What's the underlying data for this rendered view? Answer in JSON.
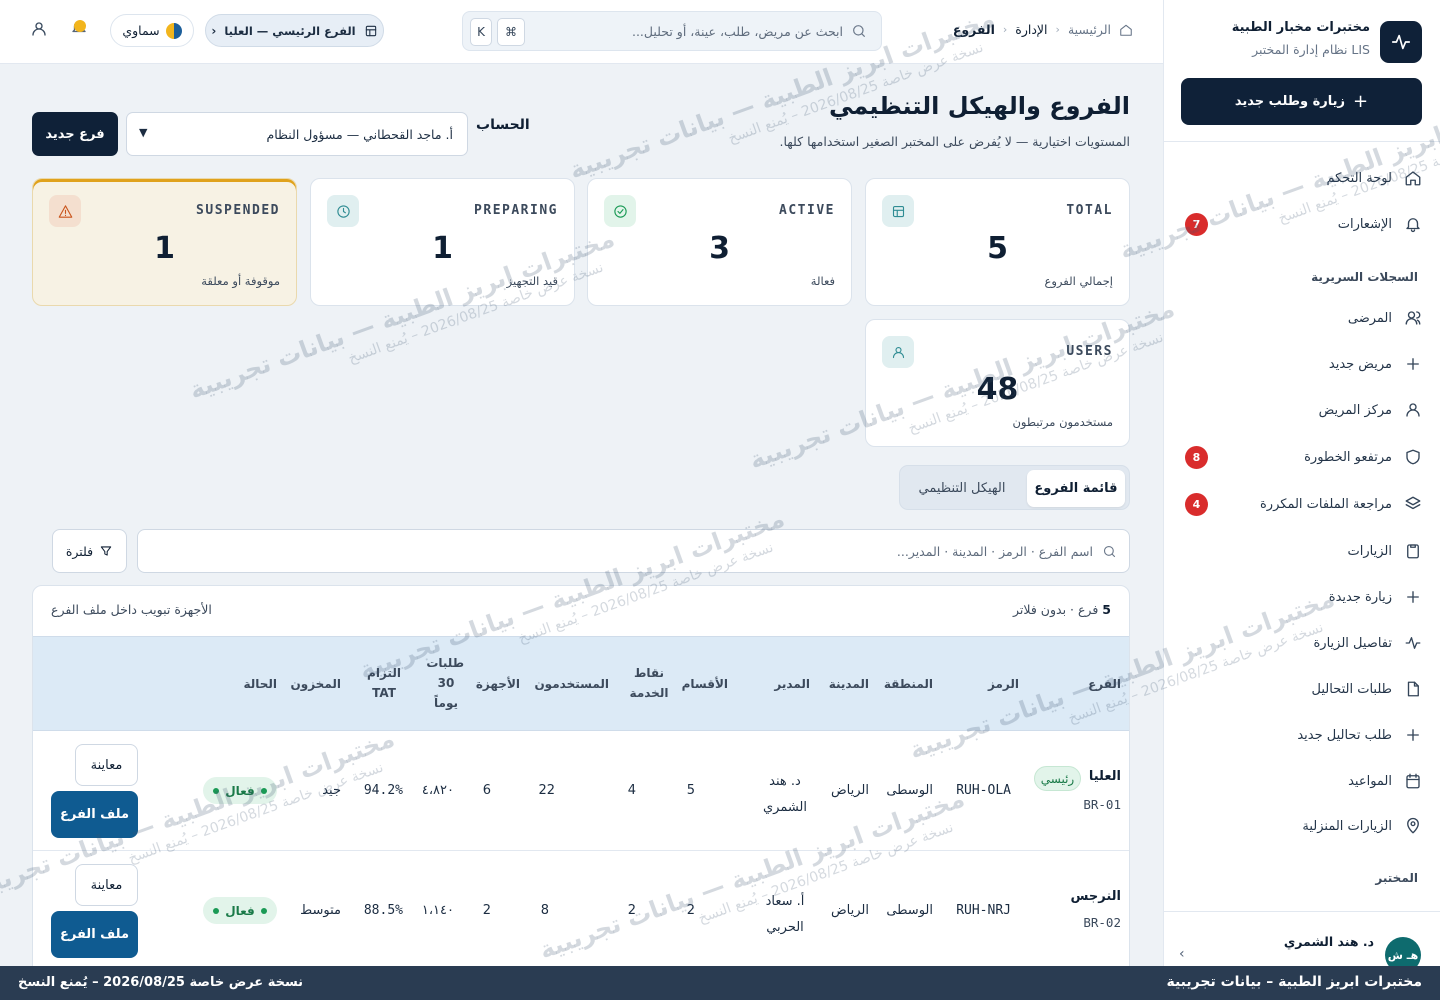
{
  "brand": {
    "title": "مختبرات مخبار الطبية",
    "subtitle": "نظام إدارة المختبر LIS",
    "cta_label": "زيارة وطلب جديد"
  },
  "nav": {
    "items": [
      {
        "label": "لوحة التحكم",
        "icon": "home-icon",
        "badge": ""
      },
      {
        "label": "الإشعارات",
        "icon": "bell-icon",
        "badge": "7"
      },
      {
        "label": "المرضى",
        "icon": "users-icon",
        "badge": ""
      },
      {
        "label": "مريض جديد",
        "icon": "plus-icon",
        "badge": ""
      },
      {
        "label": "مركز المريض",
        "icon": "user-icon",
        "badge": ""
      },
      {
        "label": "مرتفعو الخطورة",
        "icon": "shield-icon",
        "badge": "8"
      },
      {
        "label": "مراجعة الملفات المكررة",
        "icon": "layers-icon",
        "badge": "4"
      },
      {
        "label": "الزيارات",
        "icon": "clipboard-icon",
        "badge": ""
      },
      {
        "label": "زيارة جديدة",
        "icon": "plus-icon",
        "badge": ""
      },
      {
        "label": "تفاصيل الزيارة",
        "icon": "pulse-icon",
        "badge": ""
      },
      {
        "label": "طلبات التحاليل",
        "icon": "file-icon",
        "badge": ""
      },
      {
        "label": "طلب تحاليل جديد",
        "icon": "plus-icon",
        "badge": ""
      },
      {
        "label": "المواعيد",
        "icon": "calendar-icon",
        "badge": ""
      },
      {
        "label": "الزيارات المنزلية",
        "icon": "map-pin-icon",
        "badge": ""
      }
    ],
    "section_clinical": "السجلات السريرية",
    "section_lab": "المختبر"
  },
  "user": {
    "name": "د. هند الشمري",
    "initials": "هـ ش"
  },
  "topbar": {
    "breadcrumbs": [
      "الرئيسية",
      "الإدارة",
      "الفروع"
    ],
    "search_placeholder": "ابحث عن مريض، طلب، عينة، أو تحليل...",
    "kbd_cmd": "⌘",
    "kbd_k": "K",
    "branch_label": "الفرع الرئيسي — العليا",
    "theme_label": "سماوي"
  },
  "page": {
    "title": "الفروع والهيكل التنظيمي",
    "subtitle": "المستويات اختيارية — لا يُفرض على المختبر الصغير استخدامها كلها.",
    "account_label": "الحساب",
    "account_value": "أ. ماجد القحطاني — مسؤول النظام",
    "new_branch_label": "فرع جديد"
  },
  "stats": [
    {
      "label": "TOTAL",
      "value": "5",
      "caption": "إجمالي الفروع",
      "icon": "building-icon",
      "color": "#2f8c93"
    },
    {
      "label": "ACTIVE",
      "value": "3",
      "caption": "فعالة",
      "icon": "check-circle-icon",
      "color": "#1a9a55"
    },
    {
      "label": "PREPARING",
      "value": "1",
      "caption": "قيد التجهيز",
      "icon": "clock-icon",
      "color": "#2f8c93"
    },
    {
      "label": "SUSPENDED",
      "value": "1",
      "caption": "موقوفة أو معلقة",
      "icon": "warning-icon",
      "color": "#c9541c"
    },
    {
      "label": "USERS",
      "value": "48",
      "caption": "مستخدمون مرتبطون",
      "icon": "user-icon",
      "color": "#2f8c93"
    }
  ],
  "tabs": {
    "active": "قائمة الفروع",
    "inactive": "الهيكل التنظيمي"
  },
  "filter": {
    "search_placeholder": "اسم الفرع · الرمز · المدينة · المدير...",
    "button_label": "فلترة"
  },
  "table": {
    "count": "5",
    "count_suffix": "فرع · بدون فلاتر",
    "note": "الأجهزة تبويب داخل ملف الفرع",
    "headers": {
      "branch": "الفرع",
      "code": "الرمز",
      "region": "المنطقة",
      "city": "المدينة",
      "manager": "المدير",
      "departments": "الأقسام",
      "service_points": "نقاط الخدمة",
      "users": "المستخدمون",
      "devices": "الأجهزة",
      "orders_30d": "طلبات 30 يوماً",
      "tat": "التزام TAT",
      "inventory": "المخزون",
      "status": "الحالة"
    },
    "rows": [
      {
        "name": "العليا",
        "id": "BR-01",
        "main_badge": "رئيسي",
        "code": "RUH-OLA",
        "region": "الوسطى",
        "city": "الرياض",
        "manager": "د. هند الشمري",
        "departments": "5",
        "service_points": "4",
        "users": "22",
        "devices": "6",
        "orders_30d": "٤،٨٢٠",
        "tat": "94.2%",
        "inventory": "جيد",
        "status": "فعال",
        "preview_label": "معاينة",
        "profile_label": "ملف الفرع"
      },
      {
        "name": "النرجس",
        "id": "BR-02",
        "main_badge": "",
        "code": "RUH-NRJ",
        "region": "الوسطى",
        "city": "الرياض",
        "manager": "أ. سعاد الحربي",
        "departments": "2",
        "service_points": "2",
        "users": "8",
        "devices": "2",
        "orders_30d": "١،١٤٠",
        "tat": "88.5%",
        "inventory": "متوسط",
        "status": "فعال",
        "preview_label": "معاينة",
        "profile_label": "ملف الفرع"
      }
    ]
  },
  "footer": {
    "left": "نسخة عرض خاصة 2026/08/25 – يُمنع النسخ",
    "right": "مختبرات ابريز الطبية – بيانات تجريبية"
  },
  "watermark": {
    "line1": "مختبرات ابريز الطبية — بيانات تجريبية",
    "line2": "نسخة عرض خاصة 2026/08/25 – يُمنع النسخ"
  }
}
